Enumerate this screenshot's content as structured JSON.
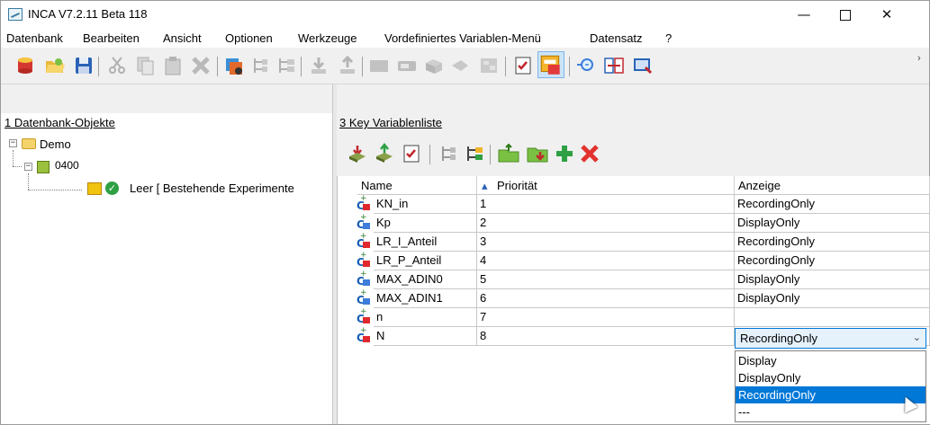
{
  "window": {
    "title": "INCA V7.2.11 Beta 118",
    "minimize": "—",
    "close": "✕"
  },
  "menu": [
    "Datenbank",
    "Bearbeiten",
    "Ansicht",
    "Optionen",
    "Werkzeuge",
    "Vordefiniertes Variablen-Menü",
    "Datensatz",
    "?"
  ],
  "toolbar": {
    "icons": [
      "database-icon",
      "folder-open-icon",
      "save-icon",
      "cut-icon",
      "copy-icon",
      "paste-icon",
      "delete-icon",
      "experiment-icon",
      "tree-collapse-icon",
      "tree-expand-icon",
      "import-icon",
      "export-icon",
      "video-icon",
      "device-icon",
      "workspace-icon",
      "probe-icon",
      "calibrate-icon",
      "checklist-icon",
      "window-layout-icon",
      "zoom-icon",
      "compare-icon",
      "monitor-icon"
    ],
    "more": "›"
  },
  "left_pane": {
    "header": "1 Datenbank-Objekte",
    "tree": {
      "root": "Demo",
      "child": "0400",
      "leaf": "Leer [ Bestehende Experimente"
    }
  },
  "right_pane": {
    "header": "3 Key Variablenliste",
    "toolbar_icons": [
      "import-icon",
      "export-icon",
      "checklist-icon",
      "tree-collapse-icon",
      "tree-expand-icon",
      "new-folder-icon",
      "move-folder-icon",
      "add-icon",
      "remove-icon"
    ],
    "columns": [
      "Name",
      "Priorität",
      "Anzeige"
    ],
    "rows": [
      {
        "name": "KN_in",
        "prio": "1",
        "anzeige": "RecordingOnly",
        "icon": "red"
      },
      {
        "name": "Kp",
        "prio": "2",
        "anzeige": "DisplayOnly",
        "icon": "blue"
      },
      {
        "name": "LR_I_Anteil",
        "prio": "3",
        "anzeige": "RecordingOnly",
        "icon": "red"
      },
      {
        "name": "LR_P_Anteil",
        "prio": "4",
        "anzeige": "RecordingOnly",
        "icon": "red"
      },
      {
        "name": "MAX_ADIN0",
        "prio": "5",
        "anzeige": "DisplayOnly",
        "icon": "blue"
      },
      {
        "name": "MAX_ADIN1",
        "prio": "6",
        "anzeige": "DisplayOnly",
        "icon": "blue"
      },
      {
        "name": "n",
        "prio": "7",
        "anzeige": "",
        "icon": "red"
      },
      {
        "name": "N",
        "prio": "8",
        "anzeige": "",
        "icon": "red"
      }
    ],
    "dropdown": {
      "selected": "RecordingOnly",
      "arrow": "⌄",
      "options": [
        "Display",
        "DisplayOnly",
        "RecordingOnly",
        "---"
      ],
      "highlighted_index": 2
    }
  }
}
